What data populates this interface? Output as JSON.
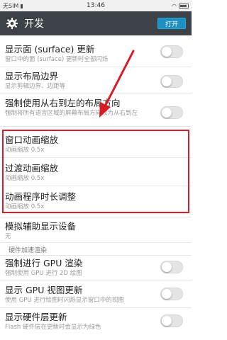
{
  "status": {
    "carrier": "无SIM",
    "time": "13:46"
  },
  "header": {
    "title": "开发",
    "toggle_label": "打开"
  },
  "settings": [
    {
      "title": "显示面 (surface) 更新",
      "subtitle": "窗口中的面 (surface) 更新时全部闪烁"
    },
    {
      "title": "显示布局边界",
      "subtitle": "显示剪辑边界、边距等"
    },
    {
      "title": "强制使用从右到左的布局方向",
      "subtitle": "强制将所有语言区域的屏幕布局方向改为从右到左"
    },
    {
      "title": "窗口动画缩放",
      "subtitle": "动画缩放 0.5x"
    },
    {
      "title": "过渡动画缩放",
      "subtitle": "动画缩放 0.5x"
    },
    {
      "title": "动画程序时长调整",
      "subtitle": "动画缩放 0.5x"
    },
    {
      "title": "模拟辅助显示设备",
      "subtitle": "无"
    },
    {
      "title": "强制进行 GPU 渲染",
      "subtitle": "强制使用 GPU 进行 2D 绘图"
    },
    {
      "title": "显示 GPU 视图更新",
      "subtitle": "使用 GPU 进行绘图时闪烁显示窗口中的视图"
    },
    {
      "title": "显示硬件层更新",
      "subtitle": "Flash 硬件层在更新时会显示为绿色"
    }
  ],
  "section_header": "硬件加速渲染",
  "colors": {
    "highlight": "#d81c25",
    "action_bar": "#3d4148",
    "accent": "#1e8fc0"
  }
}
